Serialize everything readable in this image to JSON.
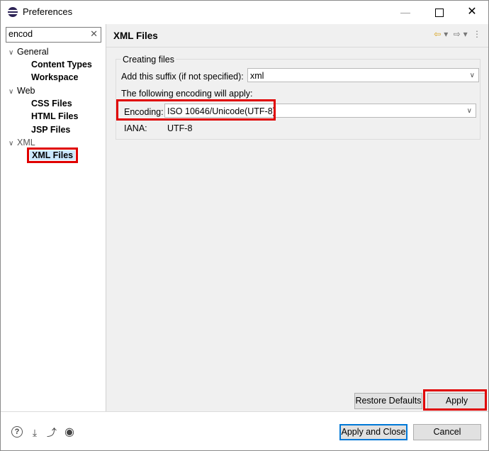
{
  "window": {
    "title": "Preferences"
  },
  "filter": {
    "value": "encod"
  },
  "tree": {
    "general": "General",
    "general_children": [
      "Content Types",
      "Workspace"
    ],
    "web": "Web",
    "web_children": [
      "CSS Files",
      "HTML Files",
      "JSP Files"
    ],
    "xml": "XML",
    "xml_children": [
      "XML Files"
    ]
  },
  "page": {
    "title": "XML Files",
    "group_title": "Creating files",
    "suffix_label": "Add this suffix (if not specified):",
    "suffix_value": "xml",
    "encoding_note": "The following encoding will apply:",
    "encoding_label": "Encoding:",
    "encoding_value": "ISO 10646/Unicode(UTF-8)",
    "iana_label": "IANA:",
    "iana_value": "UTF-8"
  },
  "buttons": {
    "restore_defaults": "Restore Defaults",
    "apply": "Apply",
    "apply_and_close": "Apply and Close",
    "cancel": "Cancel"
  },
  "icons": {
    "nav_back": "back-arrow-icon",
    "nav_forward": "forward-arrow-icon",
    "menu": "view-menu-icon",
    "help": "help-icon",
    "import": "import-icon",
    "export": "export-icon",
    "record": "record-icon"
  }
}
